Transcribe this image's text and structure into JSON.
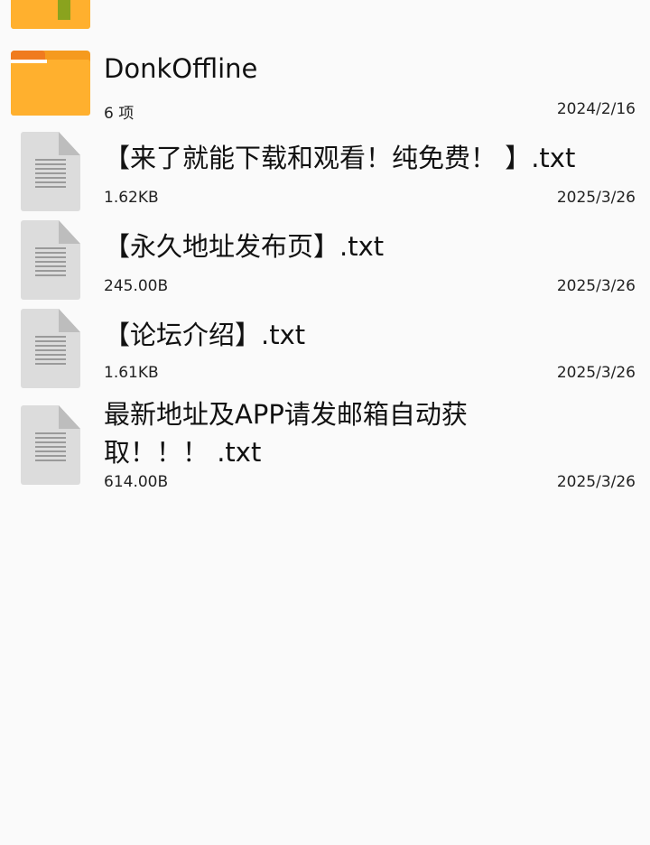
{
  "folder_partial": {
    "icon": "folder-icon"
  },
  "folder": {
    "name": "DonkOffline",
    "count": "6 项",
    "date": "2024/2/16",
    "icon": "folder-icon"
  },
  "files": [
    {
      "name": "【来了就能下载和观看！纯免费！ 】.txt",
      "size": "1.62KB",
      "date": "2025/3/26",
      "icon": "text-file-icon"
    },
    {
      "name": "【永久地址发布页】.txt",
      "size": "245.00B",
      "date": "2025/3/26",
      "icon": "text-file-icon"
    },
    {
      "name": "【论坛介绍】.txt",
      "size": "1.61KB",
      "date": "2025/3/26",
      "icon": "text-file-icon"
    },
    {
      "name": "最新地址及APP请发邮箱自动获取！！！ .txt",
      "size": "614.00B",
      "date": "2025/3/26",
      "icon": "text-file-icon"
    }
  ],
  "colors": {
    "folder": "#ffb02e",
    "folder_tab": "#f07b1e",
    "doc": "#dcdcdc",
    "background": "#fafafa"
  }
}
